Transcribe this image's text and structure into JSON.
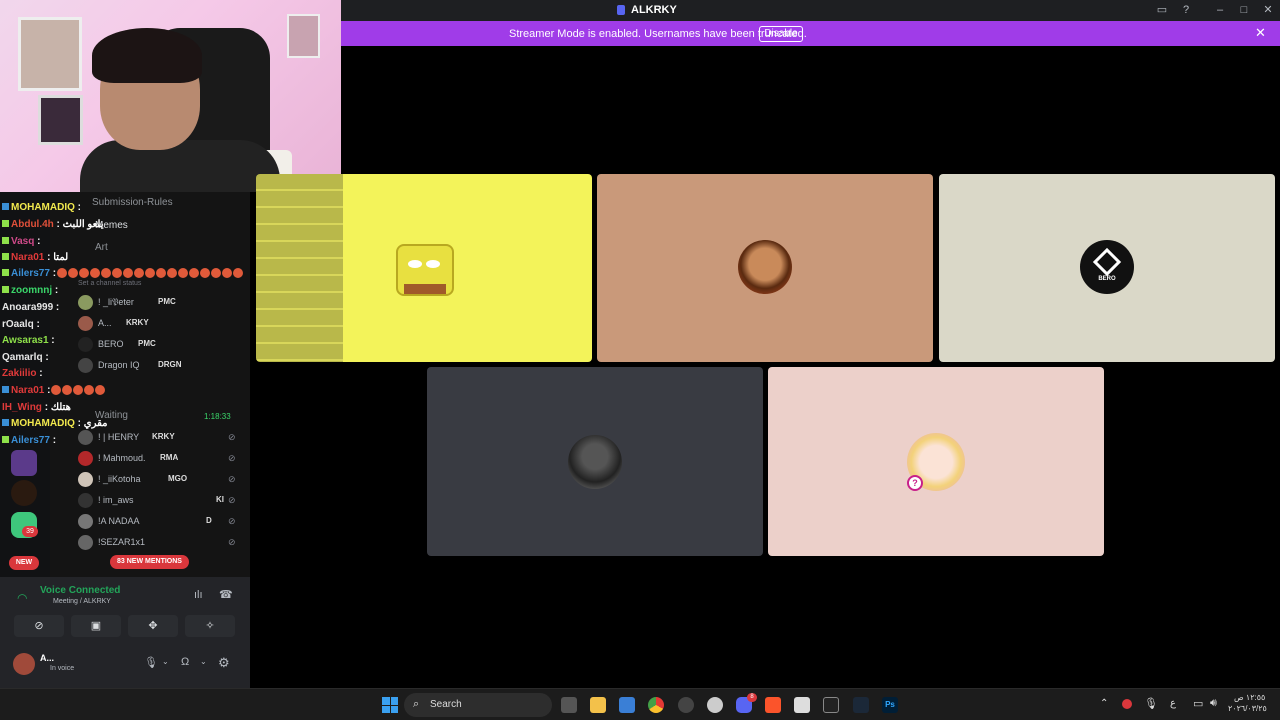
{
  "window": {
    "title": "ALKRKY"
  },
  "banner": {
    "message": "Streamer Mode is enabled. Usernames have been truncated.",
    "disable_label": "Disable"
  },
  "channels": {
    "submission_rules": "Submission-Rules",
    "memes": "Memes",
    "art": "Art",
    "waiting": "Waiting",
    "waiting_time": "1:18:33",
    "channel_status": "Set a channel status"
  },
  "voice_users": [
    {
      "name": "! _li𝔓eter",
      "tag": "PMC"
    },
    {
      "name": "A...",
      "tag": "KRKY"
    },
    {
      "name": "BERO",
      "tag": "PMC"
    },
    {
      "name": "Dragon IQ",
      "tag": "DRGN"
    },
    {
      "name": "! | HENRY",
      "tag": "KRKY"
    },
    {
      "name": "! Mahmoud.",
      "tag": "RMA"
    },
    {
      "name": "! _iiKotoha",
      "tag": "MGO"
    },
    {
      "name": "! im_aws",
      "tag": "KI"
    },
    {
      "name": "!A NADAA",
      "tag": "D"
    },
    {
      "name": "!SEZAR1x1",
      "tag": ""
    }
  ],
  "chat": [
    {
      "user": "MOHAMADIQ",
      "color": "#f2e94e",
      "msg": ""
    },
    {
      "user": "Abdul.4h",
      "color": "#e0503a",
      "msg": "يلعو اللبث"
    },
    {
      "user": "Vasq",
      "color": "#d04a8a",
      "msg": ""
    },
    {
      "user": "Nara01",
      "color": "#e03a3a",
      "msg": "لمتا"
    },
    {
      "user": "Ailers77",
      "color": "#3a8fd6",
      "msg": ""
    },
    {
      "user": "zoomnnj",
      "color": "#3ad66a",
      "msg": ""
    },
    {
      "user": "Anoara999",
      "color": "#e6e6e6",
      "msg": ""
    },
    {
      "user": "rOaalq",
      "color": "#e6e6e6",
      "msg": ""
    },
    {
      "user": "Awsaras1",
      "color": "#8ee04a",
      "msg": ""
    },
    {
      "user": "Qamarlq",
      "color": "#e6e6e6",
      "msg": ""
    },
    {
      "user": "Zakiilio",
      "color": "#e03a3a",
      "msg": ""
    },
    {
      "user": "Nara01",
      "color": "#e03a3a",
      "msg": ""
    },
    {
      "user": "IH_Wing",
      "color": "#e03a3a",
      "msg": "هتلك"
    },
    {
      "user": "MOHAMADIQ",
      "color": "#f2e94e",
      "msg": "مقري"
    },
    {
      "user": "Ailers77",
      "color": "#3a8fd6",
      "msg": ""
    }
  ],
  "mentions": {
    "count_label": "83 NEW MENTIONS",
    "new_label": "NEW",
    "badge": "39"
  },
  "voice_panel": {
    "status": "Voice Connected",
    "location": "Meeting / ALKRKY",
    "user": "A...",
    "user_status": "In voice"
  },
  "stage": {
    "tiles": [
      {
        "label": "spongebob",
        "bg": "#f3f35a"
      },
      {
        "label": "user-avatar",
        "bg": "#c9997a"
      },
      {
        "label": "bero",
        "bg": "#dad8c8",
        "text": "BERO"
      },
      {
        "label": "dark",
        "bg": "#393b42"
      },
      {
        "label": "anime",
        "bg": "#ecd0ca"
      }
    ]
  },
  "taskbar": {
    "search_label": "Search",
    "discord_badge": "8",
    "lang": "ع",
    "time": "١٢:٥٥ ص",
    "date": "٢٠٢٦/٠٣/٢٥"
  },
  "colors": {
    "accent": "#a03ce8",
    "discord_blurple": "#5865f2",
    "mention_red": "#da373c",
    "voice_green": "#23a55a"
  }
}
